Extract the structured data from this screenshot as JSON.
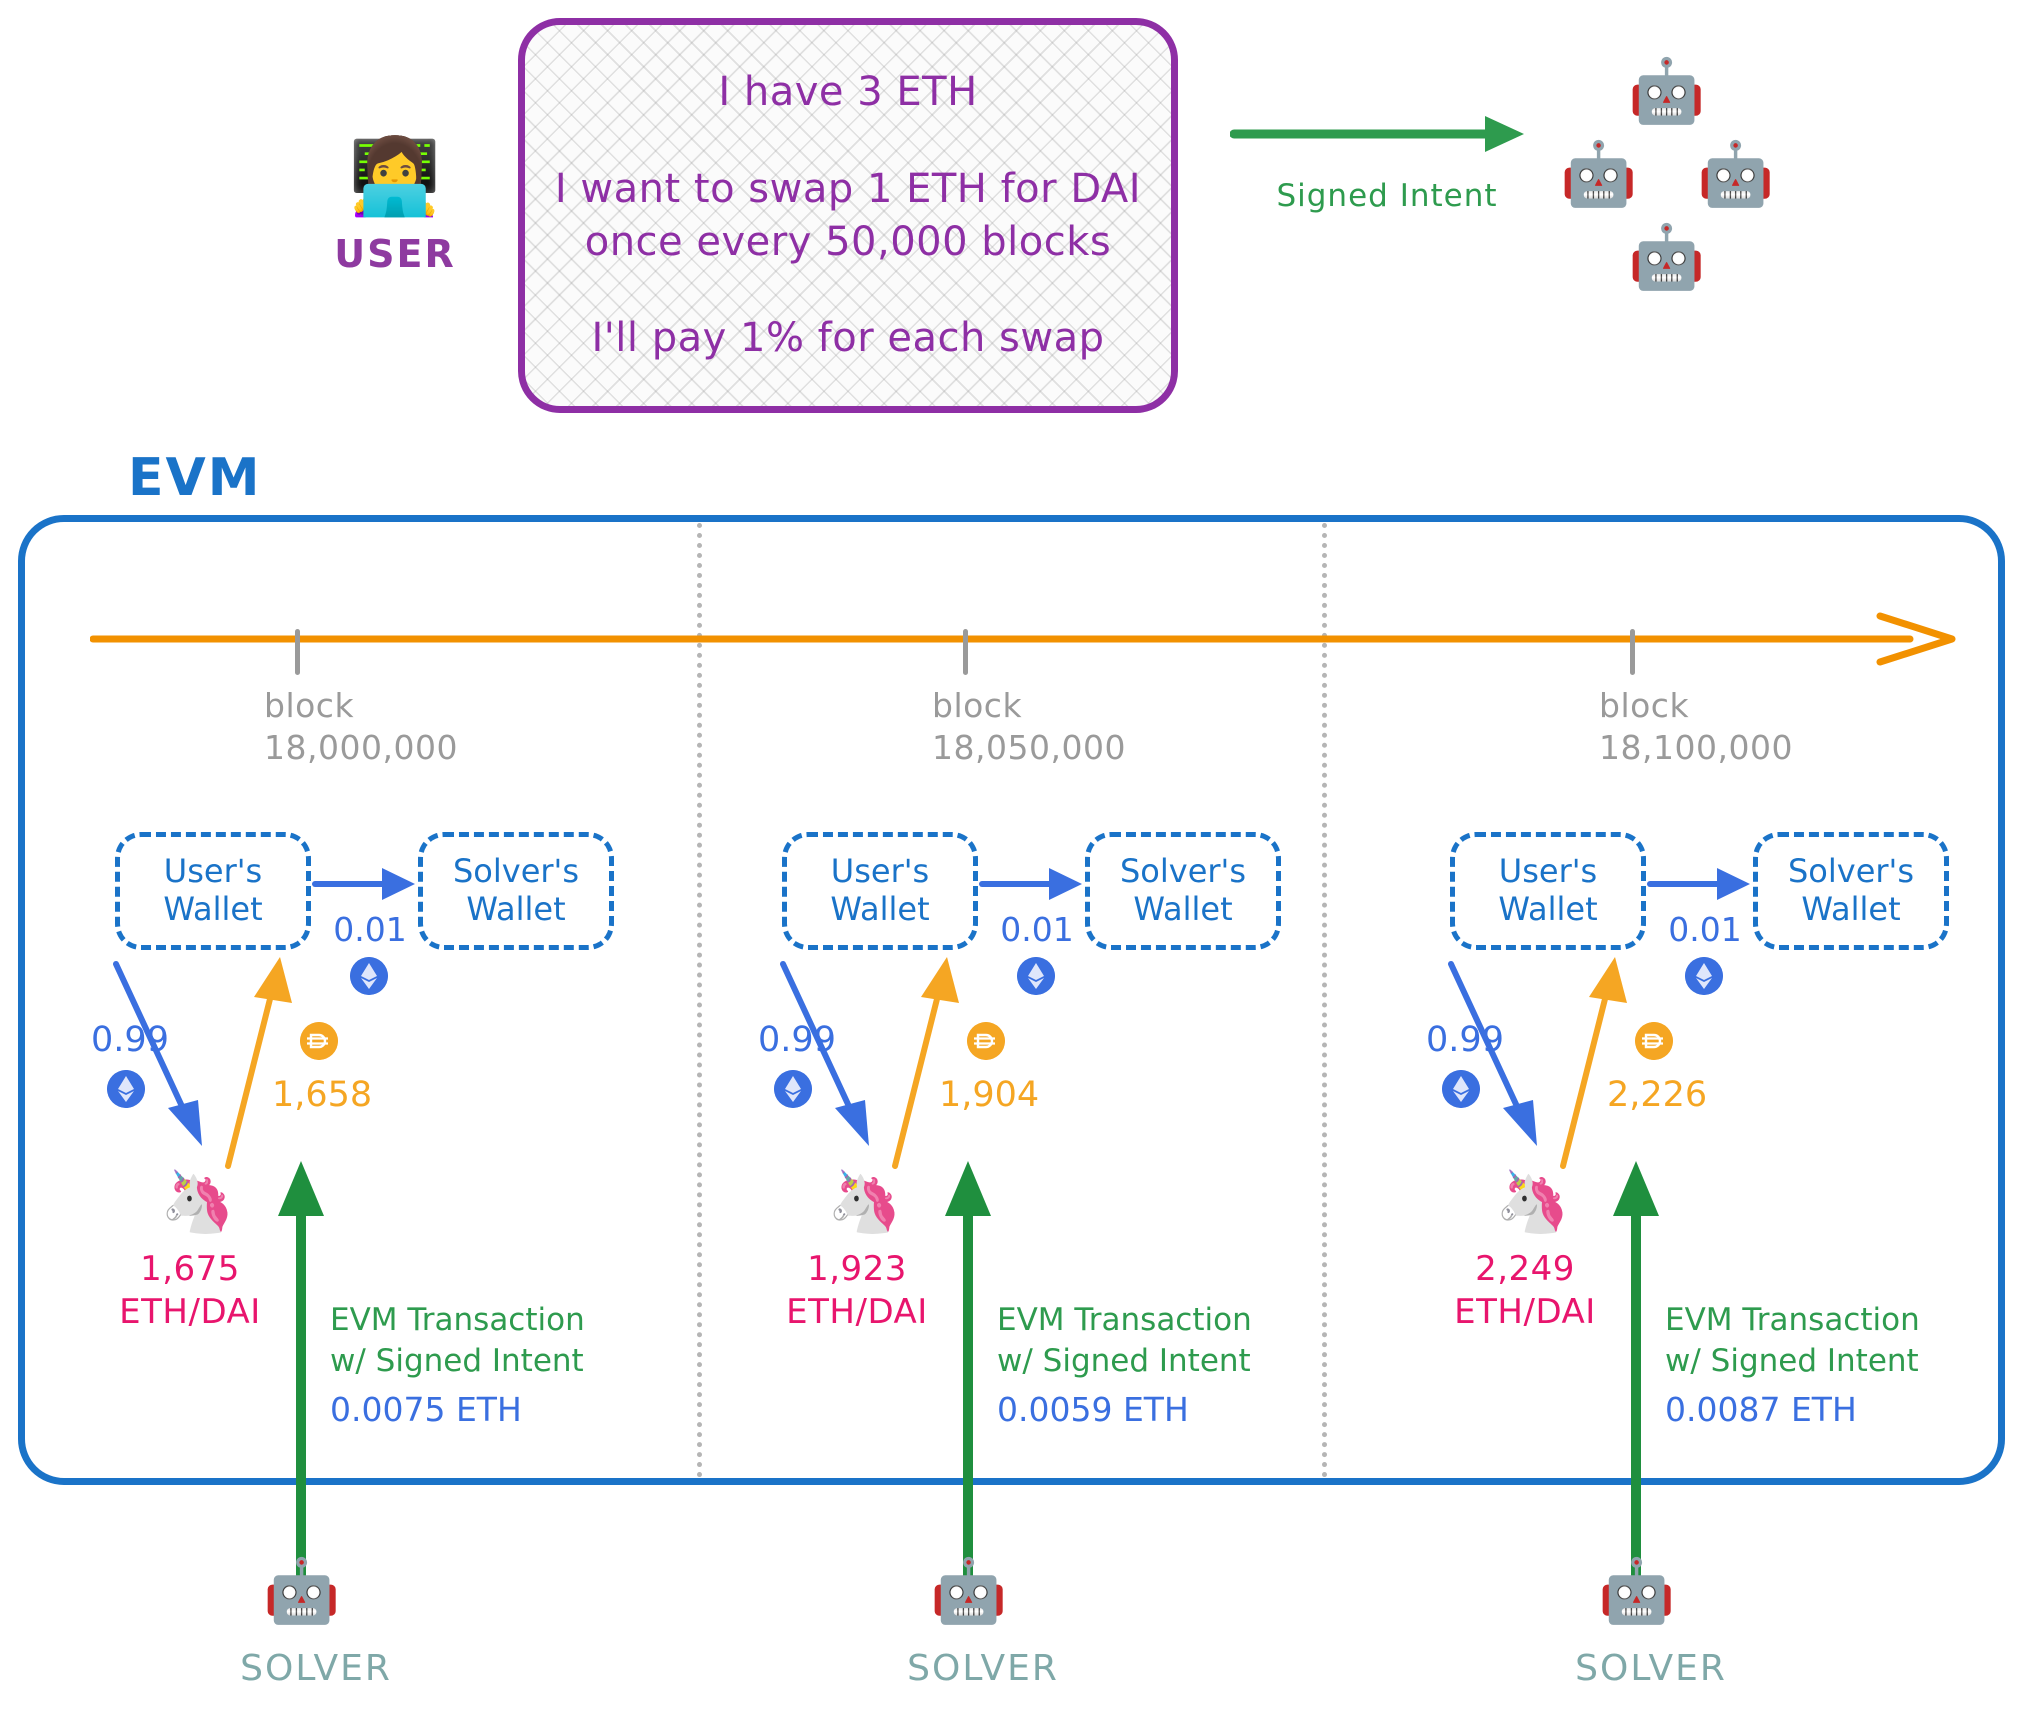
{
  "user": {
    "emoji": "👩‍💻",
    "label": "USER"
  },
  "intent": {
    "line1": "I have 3 ETH",
    "line2a": "I want to swap 1 ETH for DAI",
    "line2b": "once every 50,000 blocks",
    "line3": "I'll pay 1% for each swap"
  },
  "signed_intent": {
    "label": "Signed Intent"
  },
  "solvers_cluster": {
    "robot": "🤖",
    "count": 4
  },
  "evm": {
    "title": "EVM"
  },
  "timeline": {
    "blocks": [
      {
        "word": "block",
        "number": "18,000,000"
      },
      {
        "word": "block",
        "number": "18,050,000"
      },
      {
        "word": "block",
        "number": "18,100,000"
      }
    ]
  },
  "columns": [
    {
      "user_wallet_line1": "User's",
      "user_wallet_line2": "Wallet",
      "solver_wallet_line1": "Solver's",
      "solver_wallet_line2": "Wallet",
      "fee_amount": "0.01",
      "fee_token": "ETH",
      "eth_out_amount": "0.99",
      "eth_out_token": "ETH",
      "dai_in_amount": "1,658",
      "dai_in_token": "DAI",
      "pool_icon": "🦄",
      "pool_price": "1,675",
      "pool_pair": "ETH/DAI",
      "tx_line1": "EVM Transaction",
      "tx_line2": "w/ Signed Intent",
      "tx_cost": "0.0075 ETH",
      "solver_robot": "🤖",
      "solver_label": "SOLVER"
    },
    {
      "user_wallet_line1": "User's",
      "user_wallet_line2": "Wallet",
      "solver_wallet_line1": "Solver's",
      "solver_wallet_line2": "Wallet",
      "fee_amount": "0.01",
      "fee_token": "ETH",
      "eth_out_amount": "0.99",
      "eth_out_token": "ETH",
      "dai_in_amount": "1,904",
      "dai_in_token": "DAI",
      "pool_icon": "🦄",
      "pool_price": "1,923",
      "pool_pair": "ETH/DAI",
      "tx_line1": "EVM Transaction",
      "tx_line2": "w/ Signed Intent",
      "tx_cost": "0.0059 ETH",
      "solver_robot": "🤖",
      "solver_label": "SOLVER"
    },
    {
      "user_wallet_line1": "User's",
      "user_wallet_line2": "Wallet",
      "solver_wallet_line1": "Solver's",
      "solver_wallet_line2": "Wallet",
      "fee_amount": "0.01",
      "fee_token": "ETH",
      "eth_out_amount": "0.99",
      "eth_out_token": "ETH",
      "dai_in_amount": "2,226",
      "dai_in_token": "DAI",
      "pool_icon": "🦄",
      "pool_price": "2,249",
      "pool_pair": "ETH/DAI",
      "tx_line1": "EVM Transaction",
      "tx_line2": "w/ Signed Intent",
      "tx_cost": "0.0087 ETH",
      "solver_robot": "🤖",
      "solver_label": "SOLVER"
    }
  ],
  "colors": {
    "purple": "#8e2fa5",
    "green": "#2e9b4e",
    "blue": "#1a73c8",
    "arrow_blue": "#3a6fe0",
    "orange": "#f5a623",
    "timeline_orange": "#f29100",
    "pink": "#e8156d",
    "gray": "#9a9a9a",
    "teal": "#7fa8a8"
  }
}
